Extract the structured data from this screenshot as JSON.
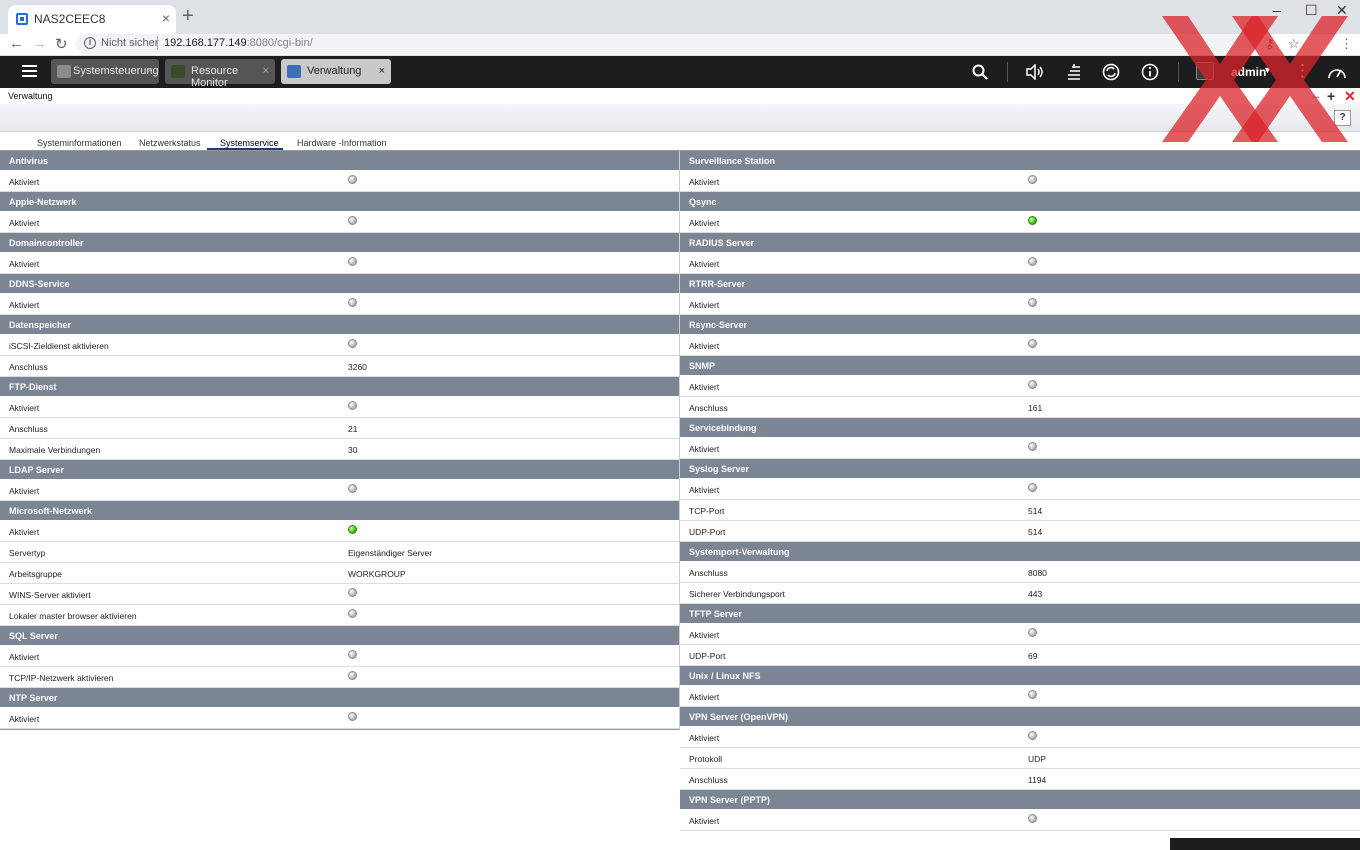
{
  "browser": {
    "tab_title": "NAS2CEEC8",
    "new_tab": "+",
    "close_tab": "×",
    "security_label": "Nicht sicher",
    "url_host": "192.168.177.149",
    "url_path": ":8080/cgi-bin/",
    "window_controls": [
      "–",
      "☐",
      "✕"
    ]
  },
  "qnap_bar": {
    "tabs": [
      {
        "label": "Systemsteuerung",
        "active": false,
        "icon_color": "#8a8a8a"
      },
      {
        "label": "Resource Monitor",
        "active": false,
        "icon_color": "#3b4a2a"
      },
      {
        "label": "Verwaltung",
        "active": true,
        "icon_color": "#3d6fb6"
      }
    ],
    "close_symbol": "×",
    "user": "admin",
    "caret": "▼",
    "icons": [
      "search-icon",
      "volume-icon",
      "stack-icon",
      "sync-icon",
      "info-icon",
      "more-icon",
      "dashboard-icon"
    ]
  },
  "window": {
    "title": "Verwaltung",
    "help": "?",
    "min": "–",
    "max": "+",
    "close": "✕"
  },
  "subtabs": [
    "Systeminformationen",
    "Netzwerkstatus",
    "Systemservice",
    "Hardware -Information"
  ],
  "active_subtab": "Systemservice",
  "left_sections": [
    {
      "title": "Antivirus",
      "rows": [
        {
          "label": "Aktiviert",
          "status": "off"
        }
      ]
    },
    {
      "title": "Apple-Netzwerk",
      "rows": [
        {
          "label": "Aktiviert",
          "status": "off"
        }
      ]
    },
    {
      "title": "Domaincontroller",
      "rows": [
        {
          "label": "Aktiviert",
          "status": "off"
        }
      ]
    },
    {
      "title": "DDNS-Service",
      "rows": [
        {
          "label": "Aktiviert",
          "status": "off"
        }
      ]
    },
    {
      "title": "Datenspeicher",
      "rows": [
        {
          "label": "iSCSI-Zieldienst aktivieren",
          "status": "off"
        },
        {
          "label": "Anschluss",
          "value": "3260"
        }
      ]
    },
    {
      "title": "FTP-Dienst",
      "rows": [
        {
          "label": "Aktiviert",
          "status": "off"
        },
        {
          "label": "Anschluss",
          "value": "21"
        },
        {
          "label": "Maximale Verbindungen",
          "value": "30"
        }
      ]
    },
    {
      "title": "LDAP Server",
      "rows": [
        {
          "label": "Aktiviert",
          "status": "off"
        }
      ]
    },
    {
      "title": "Microsoft-Netzwerk",
      "rows": [
        {
          "label": "Aktiviert",
          "status": "on"
        },
        {
          "label": "Servertyp",
          "value": "Eigenständiger Server"
        },
        {
          "label": "Arbeitsgruppe",
          "value": "WORKGROUP"
        },
        {
          "label": "WINS-Server aktiviert",
          "status": "off"
        },
        {
          "label": "Lokaler master browser aktivieren",
          "status": "off"
        }
      ]
    },
    {
      "title": "SQL Server",
      "rows": [
        {
          "label": "Aktiviert",
          "status": "off"
        },
        {
          "label": "TCP/IP-Netzwerk aktivieren",
          "status": "off"
        }
      ]
    },
    {
      "title": "NTP Server",
      "rows": [
        {
          "label": "Aktiviert",
          "status": "off"
        }
      ]
    }
  ],
  "right_sections": [
    {
      "title": "Surveillance Station",
      "rows": [
        {
          "label": "Aktiviert",
          "status": "off"
        }
      ]
    },
    {
      "title": "Qsync",
      "rows": [
        {
          "label": "Aktiviert",
          "status": "on"
        }
      ]
    },
    {
      "title": "RADIUS Server",
      "rows": [
        {
          "label": "Aktiviert",
          "status": "off"
        }
      ]
    },
    {
      "title": "RTRR-Server",
      "rows": [
        {
          "label": "Aktiviert",
          "status": "off"
        }
      ]
    },
    {
      "title": "Rsync-Server",
      "rows": [
        {
          "label": "Aktiviert",
          "status": "off"
        }
      ]
    },
    {
      "title": "SNMP",
      "rows": [
        {
          "label": "Aktiviert",
          "status": "off"
        },
        {
          "label": "Anschluss",
          "value": "161"
        }
      ]
    },
    {
      "title": "Servicebindung",
      "rows": [
        {
          "label": "Aktiviert",
          "status": "off"
        }
      ]
    },
    {
      "title": "Syslog Server",
      "rows": [
        {
          "label": "Aktiviert",
          "status": "off"
        },
        {
          "label": "TCP-Port",
          "value": "514"
        },
        {
          "label": "UDP-Port",
          "value": "514"
        }
      ]
    },
    {
      "title": "Systemport-Verwaltung",
      "rows": [
        {
          "label": "Anschluss",
          "value": "8080"
        },
        {
          "label": "Sicherer Verbindungsport",
          "value": "443"
        }
      ]
    },
    {
      "title": "TFTP Server",
      "rows": [
        {
          "label": "Aktiviert",
          "status": "off"
        },
        {
          "label": "UDP-Port",
          "value": "69"
        }
      ]
    },
    {
      "title": "Unix / Linux NFS",
      "rows": [
        {
          "label": "Aktiviert",
          "status": "off"
        }
      ]
    },
    {
      "title": "VPN Server (OpenVPN)",
      "rows": [
        {
          "label": "Aktiviert",
          "status": "off"
        },
        {
          "label": "Protokoll",
          "value": "UDP"
        },
        {
          "label": "Anschluss",
          "value": "1194"
        }
      ]
    },
    {
      "title": "VPN Server (PPTP)",
      "rows": [
        {
          "label": "Aktiviert",
          "status": "off"
        }
      ]
    }
  ],
  "colors": {
    "section_header": "#7c8594",
    "status_on": "#3fbe22",
    "status_off": "#b8b8b8",
    "watermark": "#d9232a"
  }
}
